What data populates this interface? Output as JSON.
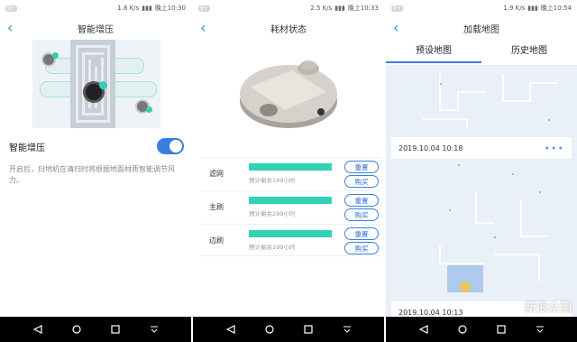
{
  "panels": [
    {
      "status": {
        "badge": "9+",
        "speed": "1.8 K/s",
        "time": "晚上10:30"
      },
      "title": "智能增压",
      "setting_label": "智能增压",
      "toggle_on": true,
      "description": "开启后，扫地机在清扫时将根据地面材质智能调节风力。"
    },
    {
      "status": {
        "badge": "9+",
        "speed": "2.5 K/s",
        "time": "晚上10:33"
      },
      "title": "耗材状态",
      "items": [
        {
          "label": "滤网",
          "remain": "预计剩余149小时",
          "level": 1.0,
          "reset": "重置",
          "buy": "购买"
        },
        {
          "label": "主刷",
          "remain": "预计剩余299小时",
          "level": 1.0,
          "reset": "重置",
          "buy": "购买"
        },
        {
          "label": "边刷",
          "remain": "预计剩余199小时",
          "level": 1.0,
          "reset": "重置",
          "buy": "购买"
        }
      ]
    },
    {
      "status": {
        "badge": "9+",
        "speed": "1.9 K/s",
        "time": "晚上10:54"
      },
      "title": "加载地图",
      "tabs": [
        "预设地图",
        "历史地图"
      ],
      "maps": [
        {
          "date": "2019.10.04 10:18",
          "more": "•••"
        },
        {
          "date": "2019.10.04 10:13"
        }
      ],
      "watermark": "新浪众测"
    }
  ],
  "colors": {
    "accent": "#3a7fe0",
    "bar": "#32d2b4",
    "map_bg": "#e9f0f8"
  },
  "icons": {
    "back": "‹",
    "nav_back": "◁",
    "nav_home": "○",
    "nav_recent": "□",
    "nav_menu": "⩡"
  }
}
